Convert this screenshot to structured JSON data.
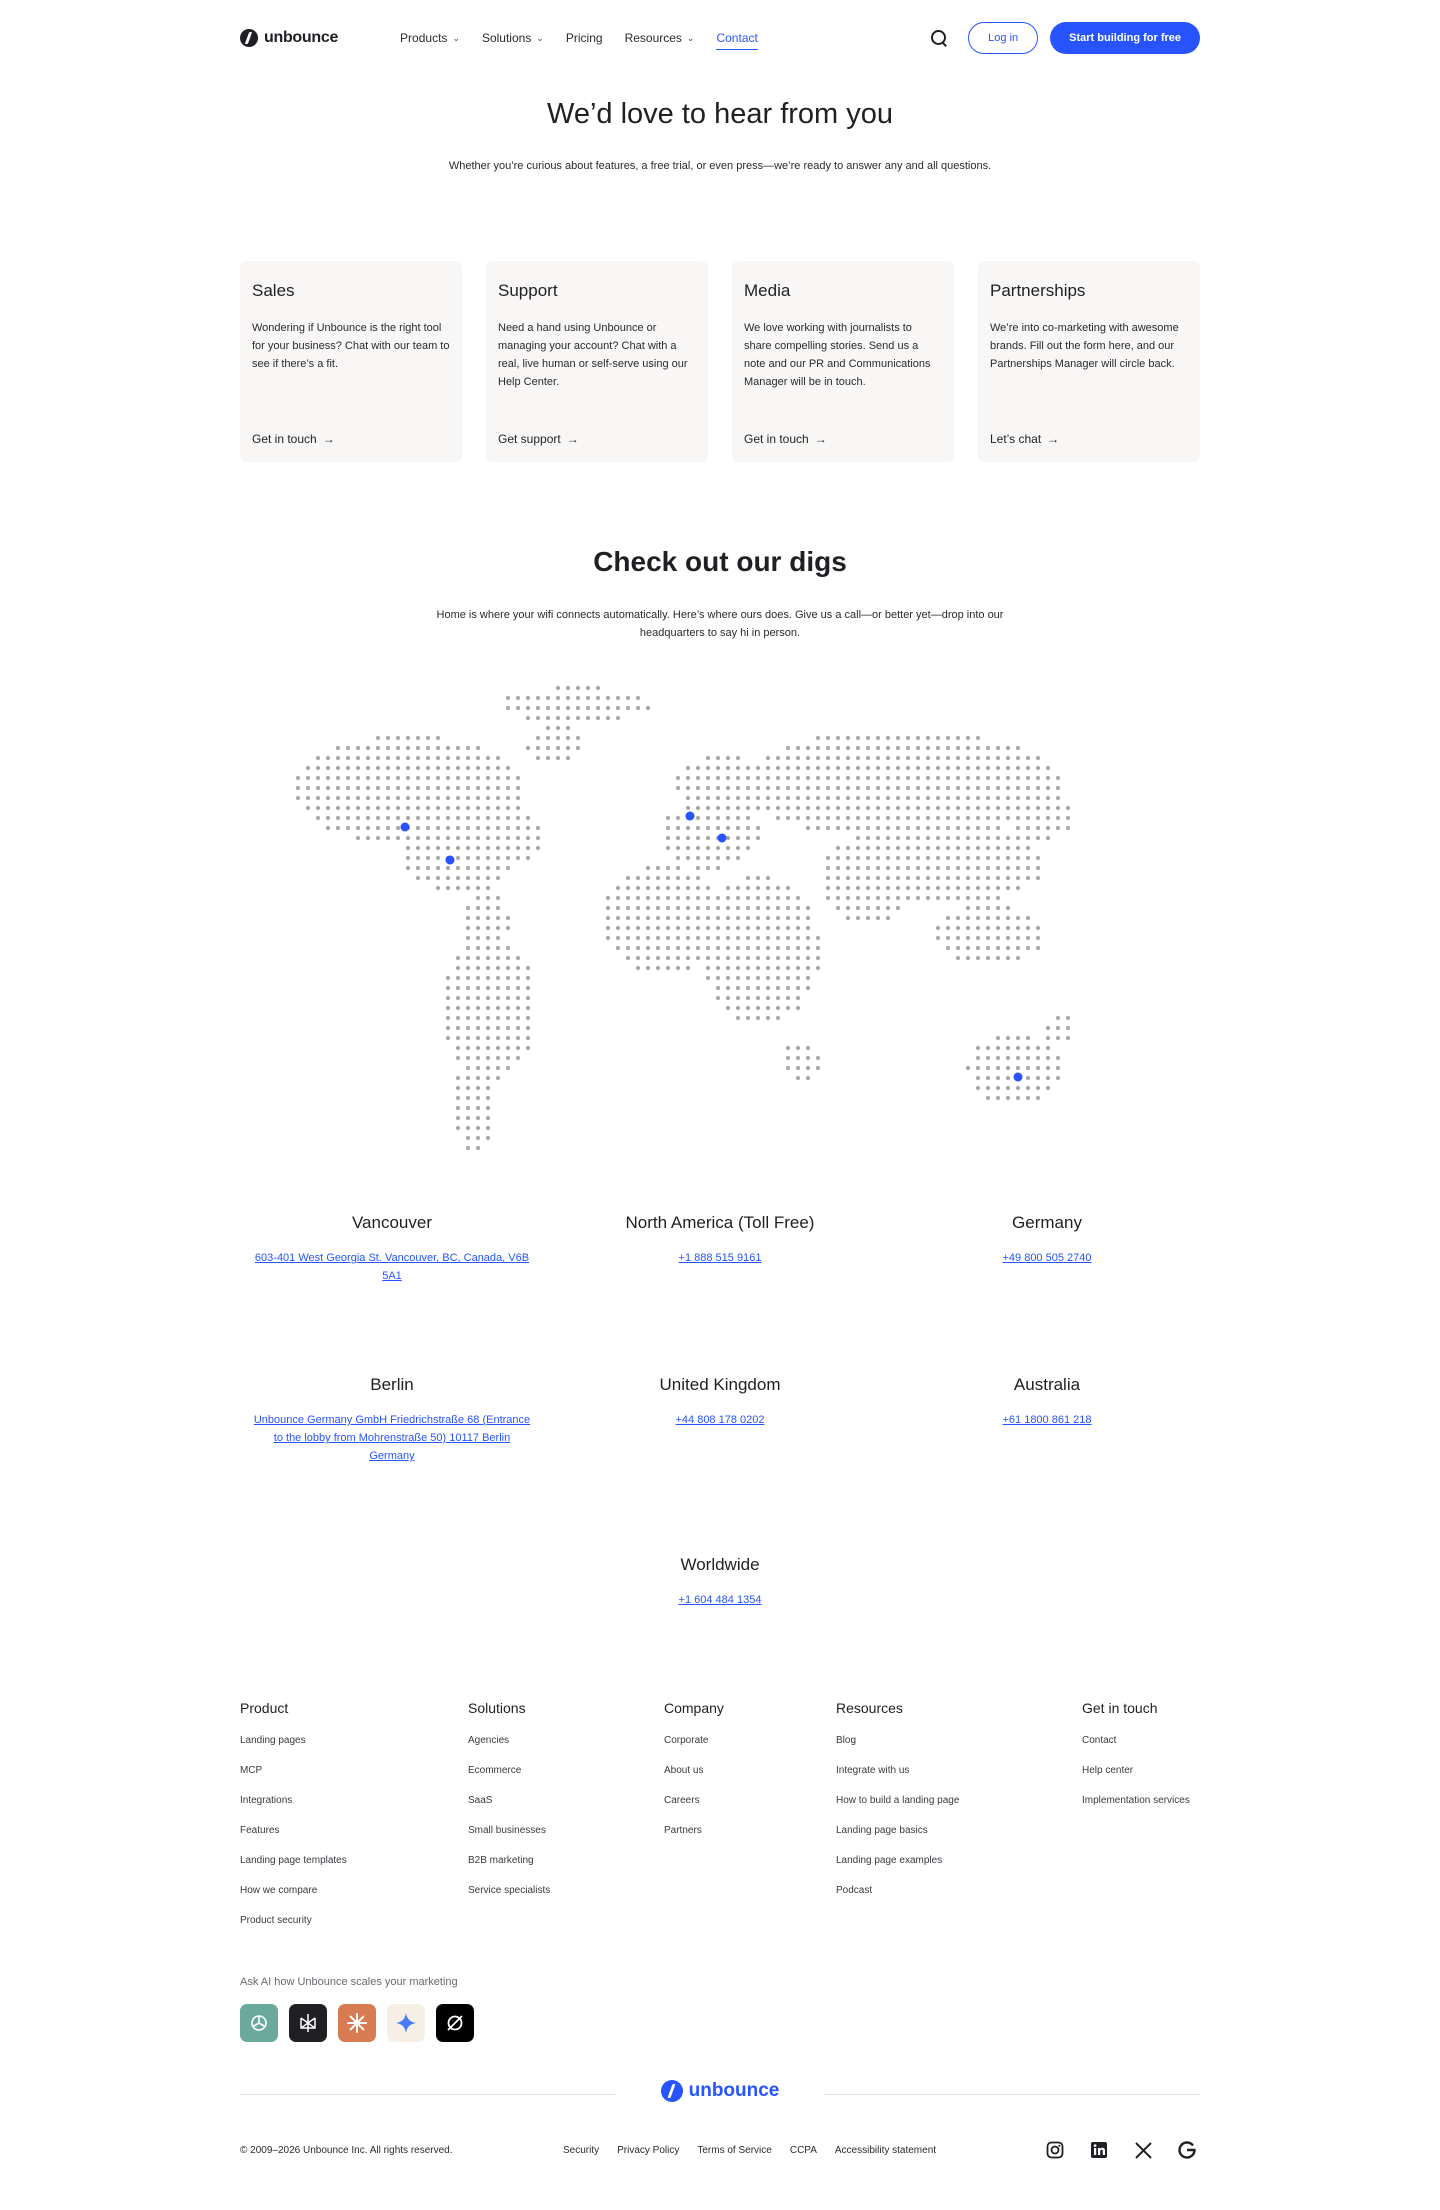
{
  "nav": {
    "logo_text": "unbounce",
    "links": [
      {
        "label": "Products",
        "dropdown": true
      },
      {
        "label": "Solutions",
        "dropdown": true
      },
      {
        "label": "Pricing",
        "dropdown": false
      },
      {
        "label": "Resources",
        "dropdown": true
      },
      {
        "label": "Contact",
        "dropdown": false,
        "active": true
      }
    ],
    "login_label": "Log in",
    "cta_label": "Start building for free"
  },
  "hero": {
    "title": "We’d love to hear from you",
    "subtitle": "Whether you’re curious about features, a free trial, or even press—we’re ready to answer any and all questions."
  },
  "cards": [
    {
      "title": "Sales",
      "body": "Wondering if Unbounce is the right tool for your business? Chat with our team to see if there’s a fit.",
      "link": "Get in touch"
    },
    {
      "title": "Support",
      "body": "Need a hand using Unbounce or managing your account? Chat with a real, live human or self-serve using our Help Center.",
      "link": "Get support"
    },
    {
      "title": "Media",
      "body": "We love working with journalists to share compelling stories. Send us a note and our PR and Communications Manager will be in touch.",
      "link": "Get in touch"
    },
    {
      "title": "Partnerships",
      "body": "We’re into co-marketing with awesome brands. Fill out the form here, and our Partnerships Manager will circle back.",
      "link": "Let’s chat"
    }
  ],
  "digs": {
    "title": "Check out our digs",
    "subtitle": "Home is where your wifi connects automatically. Here’s where ours does. Give us a call—or better yet—drop into our headquarters to say hi in person."
  },
  "locations": [
    {
      "name": "Vancouver",
      "link": "603-401 West Georgia St. Vancouver, BC, Canada, V6B 5A1"
    },
    {
      "name": "North America (Toll Free)",
      "link": "+1 888 515 9161"
    },
    {
      "name": "Germany",
      "link": "+49 800 505 2740"
    },
    {
      "name": "Berlin",
      "link": "Unbounce Germany GmbH Friedrichstraße 68 (Entrance to the lobby from Mohrenstraße 50) 10117 Berlin Germany"
    },
    {
      "name": "United Kingdom",
      "link": "+44 808 178 0202"
    },
    {
      "name": "Australia",
      "link": "+61 1800 861 218"
    },
    {
      "name": "Worldwide",
      "link": "+1 604 484 1354"
    }
  ],
  "footer": {
    "columns": [
      {
        "title": "Product",
        "items": [
          "Landing pages",
          "MCP",
          "Integrations",
          "Features",
          "Landing page templates",
          "How we compare",
          "Product security"
        ]
      },
      {
        "title": "Solutions",
        "items": [
          "Agencies",
          "Ecommerce",
          "SaaS",
          "Small businesses",
          "B2B marketing",
          "Service specialists"
        ]
      },
      {
        "title": "Company",
        "items": [
          "Corporate",
          "About us",
          "Careers",
          "Partners"
        ]
      },
      {
        "title": "Resources",
        "items": [
          "Blog",
          "Integrate with us",
          "How to build a landing page",
          "Landing page basics",
          "Landing page examples",
          "Podcast"
        ]
      },
      {
        "title": "Get in touch",
        "items": [
          "Contact",
          "Help center",
          "Implementation services"
        ]
      }
    ],
    "ai_label": "Ask AI how Unbounce scales your marketing",
    "ai_tools": [
      {
        "icon": "chatgpt-icon",
        "color": "#6aa99b"
      },
      {
        "icon": "perplexity-icon",
        "color": "#1f1f24"
      },
      {
        "icon": "claude-icon",
        "color": "#d97b52"
      },
      {
        "icon": "gemini-icon",
        "color": "#f5efe6"
      },
      {
        "icon": "grok-icon",
        "color": "#000000"
      }
    ],
    "logo_text": "unbounce",
    "copyright": "© 2009–2026 Unbounce Inc. All rights reserved.",
    "legal_links": [
      "Security",
      "Privacy Policy",
      "Terms of Service",
      "CCPA",
      "Accessibility statement"
    ],
    "social": [
      "instagram-icon",
      "linkedin-icon",
      "x-icon",
      "g2-icon"
    ]
  },
  "colors": {
    "accent": "#2754ff",
    "card_bg": "#f8f7f5",
    "map_dot": "#a9a9a9",
    "map_marker": "#2754ff"
  }
}
